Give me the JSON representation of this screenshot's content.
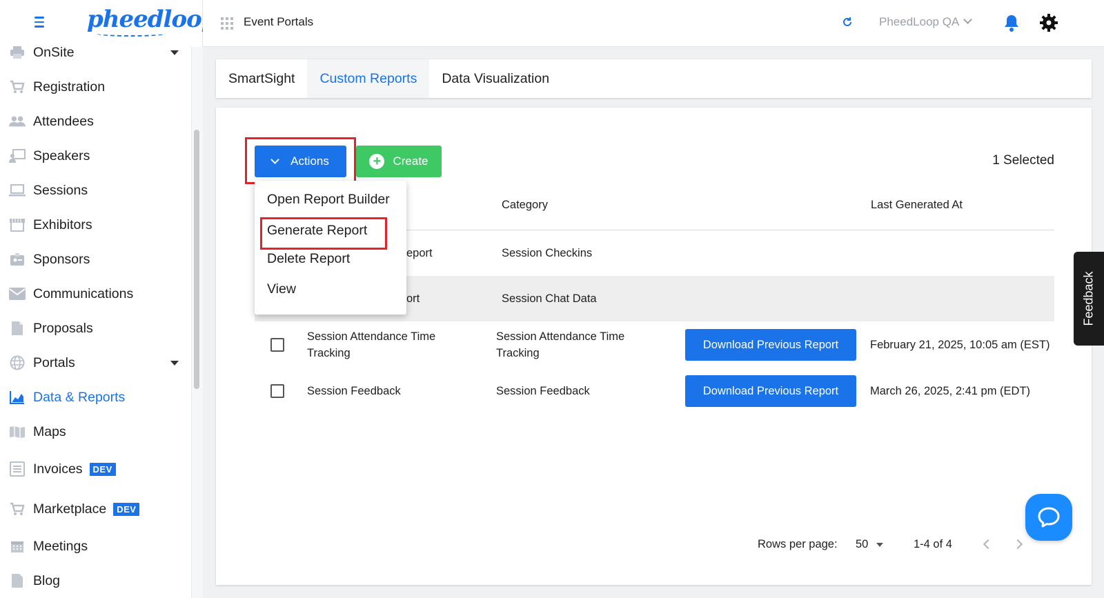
{
  "brand": {
    "logo_text": "pheedloop"
  },
  "sidebar": {
    "items": [
      {
        "label": "OnSite",
        "icon": "printer-icon",
        "has_caret": true
      },
      {
        "label": "Registration",
        "icon": "cart-icon"
      },
      {
        "label": "Attendees",
        "icon": "people-icon"
      },
      {
        "label": "Speakers",
        "icon": "presenter-icon"
      },
      {
        "label": "Sessions",
        "icon": "laptop-icon"
      },
      {
        "label": "Exhibitors",
        "icon": "storefront-icon"
      },
      {
        "label": "Sponsors",
        "icon": "badge-icon"
      },
      {
        "label": "Communications",
        "icon": "mail-icon"
      },
      {
        "label": "Proposals",
        "icon": "document-icon"
      },
      {
        "label": "Portals",
        "icon": "globe-icon",
        "has_caret": true
      },
      {
        "label": "Data & Reports",
        "icon": "chart-icon",
        "active": true
      },
      {
        "label": "Maps",
        "icon": "map-icon"
      },
      {
        "label": "Invoices",
        "icon": "list-icon",
        "badge": "DEV"
      },
      {
        "label": "Marketplace",
        "icon": "cart-icon",
        "badge": "DEV"
      },
      {
        "label": "Meetings",
        "icon": "calendar-icon"
      },
      {
        "label": "Blog",
        "icon": "page-icon"
      }
    ]
  },
  "topbar": {
    "title": "Event Portals",
    "workspace": "PheedLoop QA"
  },
  "tabs": [
    {
      "label": "SmartSight"
    },
    {
      "label": "Custom Reports",
      "active": true
    },
    {
      "label": "Data Visualization"
    }
  ],
  "toolbar": {
    "actions_label": "Actions",
    "create_label": "Create",
    "selected_text": "1 Selected"
  },
  "actions_menu": {
    "items": [
      "Open Report Builder",
      "Generate Report",
      "Delete Report",
      "View"
    ]
  },
  "table": {
    "headers": {
      "category": "Category",
      "last_generated": "Last Generated At"
    },
    "rows": [
      {
        "name": "eport",
        "category": "Session Checkins",
        "button": "",
        "last_generated": ""
      },
      {
        "name": "ort",
        "category": "Session Chat Data",
        "button": "",
        "last_generated": ""
      },
      {
        "name": "Session Attendance Time Tracking",
        "category": "Session Attendance Time Tracking",
        "button": "Download Previous Report",
        "last_generated": "February 21, 2025, 10:05 am (EST)"
      },
      {
        "name": "Session Feedback",
        "category": "Session Feedback",
        "button": "Download Previous Report",
        "last_generated": "March 26, 2025, 2:41 pm (EDT)"
      }
    ]
  },
  "pagination": {
    "rows_per_page_label": "Rows per page:",
    "rows_per_page_value": "50",
    "range_text": "1-4 of 4"
  },
  "feedback_label": "Feedback",
  "colors": {
    "primary": "#1a73e8",
    "success": "#3ec964",
    "highlight": "#e32329"
  }
}
